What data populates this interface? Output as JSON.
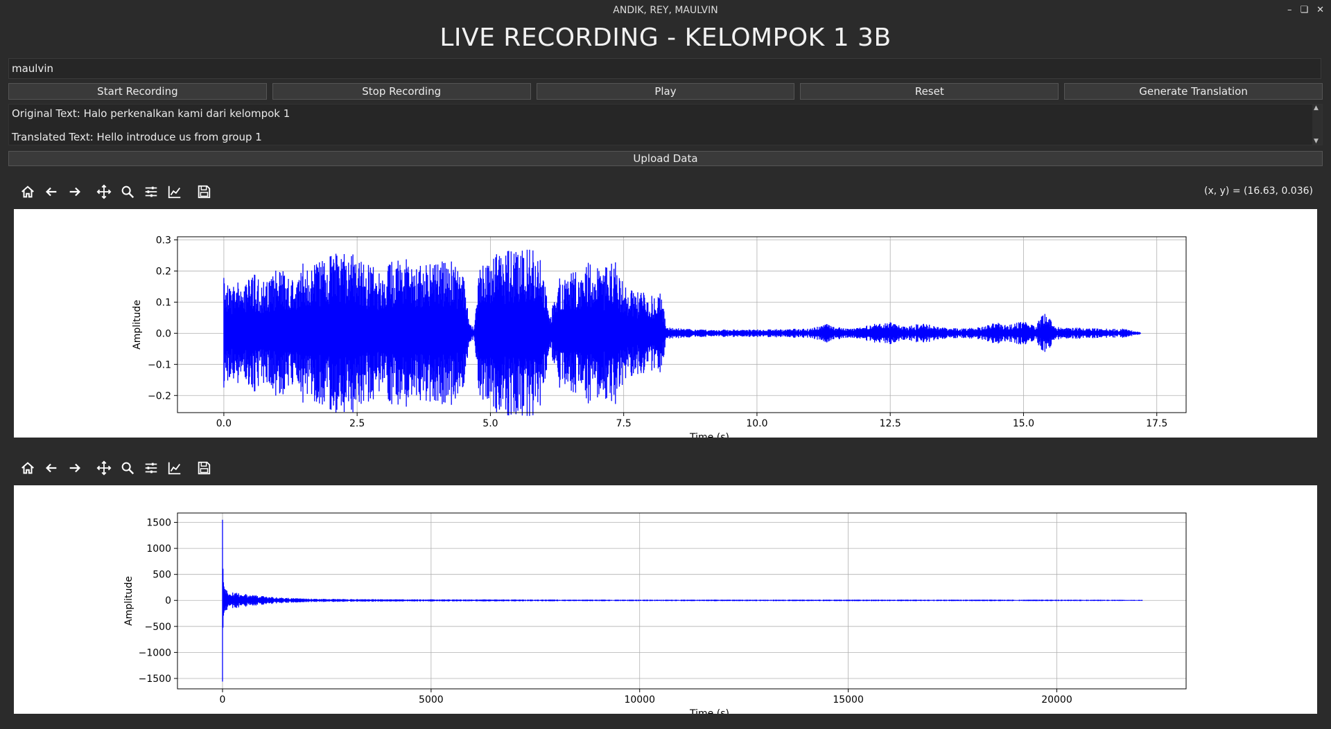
{
  "window": {
    "title": "ANDIK, REY, MAULVIN",
    "controls": [
      "minimize-icon",
      "restore-icon",
      "close-icon"
    ]
  },
  "app_title": "LIVE RECORDING - KELOMPOK 1 3B",
  "name_field": {
    "value": "maulvin"
  },
  "buttons": {
    "start": "Start Recording",
    "stop": "Stop Recording",
    "play": "Play",
    "reset": "Reset",
    "generate": "Generate Translation",
    "upload": "Upload Data"
  },
  "output": {
    "original": "Original Text: Halo perkenalkan kami dari kelompok 1",
    "translated": "Translated Text: Hello introduce us from group 1"
  },
  "toolbar_icons": [
    "home-icon",
    "back-icon",
    "forward-icon",
    "pan-icon",
    "zoom-icon",
    "configure-subplots-icon",
    "edit-axes-icon",
    "save-icon"
  ],
  "coords_readout": "(x, y) = (16.63, 0.036)",
  "colors": {
    "signal": "#0000ff",
    "background": "#2b2b2b",
    "button": "#3a3a3a"
  },
  "chart_data": [
    {
      "type": "line",
      "title": "",
      "xlabel": "Time (s)",
      "ylabel": "Amplitude",
      "xlim": [
        -0.87,
        18.05
      ],
      "ylim": [
        -0.255,
        0.31
      ],
      "xticks": [
        0.0,
        2.5,
        5.0,
        7.5,
        10.0,
        12.5,
        15.0,
        17.5
      ],
      "xtick_labels": [
        "0.0",
        "2.5",
        "5.0",
        "7.5",
        "10.0",
        "12.5",
        "15.0",
        "17.5"
      ],
      "yticks": [
        -0.2,
        -0.1,
        0.0,
        0.1,
        0.2,
        0.3
      ],
      "ytick_labels": [
        "−0.2",
        "−0.1",
        "0.0",
        "0.1",
        "0.2",
        "0.3"
      ],
      "grid": true,
      "color": "#0000ff",
      "duration": 17.2,
      "envelope": [
        [
          0.0,
          0.19
        ],
        [
          0.1,
          0.15
        ],
        [
          0.3,
          0.18
        ],
        [
          0.5,
          0.2
        ],
        [
          0.7,
          0.18
        ],
        [
          0.9,
          0.2
        ],
        [
          1.1,
          0.21
        ],
        [
          1.3,
          0.19
        ],
        [
          1.5,
          0.23
        ],
        [
          1.7,
          0.22
        ],
        [
          1.9,
          0.25
        ],
        [
          2.1,
          0.26
        ],
        [
          2.3,
          0.26
        ],
        [
          2.5,
          0.25
        ],
        [
          2.7,
          0.22
        ],
        [
          2.9,
          0.21
        ],
        [
          3.1,
          0.23
        ],
        [
          3.3,
          0.25
        ],
        [
          3.5,
          0.24
        ],
        [
          3.7,
          0.22
        ],
        [
          3.9,
          0.23
        ],
        [
          4.1,
          0.24
        ],
        [
          4.3,
          0.23
        ],
        [
          4.5,
          0.21
        ],
        [
          4.6,
          0.03
        ],
        [
          4.7,
          0.02
        ],
        [
          4.8,
          0.22
        ],
        [
          5.0,
          0.25
        ],
        [
          5.2,
          0.26
        ],
        [
          5.4,
          0.27
        ],
        [
          5.5,
          0.26
        ],
        [
          5.7,
          0.28
        ],
        [
          5.9,
          0.27
        ],
        [
          6.0,
          0.2
        ],
        [
          6.1,
          0.05
        ],
        [
          6.3,
          0.18
        ],
        [
          6.5,
          0.22
        ],
        [
          6.7,
          0.21
        ],
        [
          6.9,
          0.24
        ],
        [
          7.1,
          0.2
        ],
        [
          7.3,
          0.25
        ],
        [
          7.5,
          0.16
        ],
        [
          7.7,
          0.13
        ],
        [
          7.9,
          0.14
        ],
        [
          8.1,
          0.11
        ],
        [
          8.2,
          0.14
        ],
        [
          8.3,
          0.02
        ],
        [
          8.6,
          0.015
        ],
        [
          9.0,
          0.012
        ],
        [
          9.5,
          0.012
        ],
        [
          10.0,
          0.012
        ],
        [
          10.5,
          0.014
        ],
        [
          11.0,
          0.015
        ],
        [
          11.3,
          0.03
        ],
        [
          11.5,
          0.02
        ],
        [
          11.8,
          0.015
        ],
        [
          12.2,
          0.03
        ],
        [
          12.5,
          0.035
        ],
        [
          12.8,
          0.02
        ],
        [
          13.1,
          0.035
        ],
        [
          13.4,
          0.02
        ],
        [
          13.8,
          0.015
        ],
        [
          14.2,
          0.02
        ],
        [
          14.5,
          0.035
        ],
        [
          14.7,
          0.025
        ],
        [
          15.0,
          0.04
        ],
        [
          15.2,
          0.025
        ],
        [
          15.4,
          0.07
        ],
        [
          15.6,
          0.02
        ],
        [
          16.0,
          0.018
        ],
        [
          16.5,
          0.015
        ],
        [
          16.9,
          0.015
        ],
        [
          17.2,
          0.003
        ]
      ]
    },
    {
      "type": "line",
      "title": "",
      "xlabel": "Time (s)",
      "ylabel": "Amplitude",
      "xlim": [
        -1080,
        23100
      ],
      "ylim": [
        -1700,
        1680
      ],
      "xticks": [
        0,
        5000,
        10000,
        15000,
        20000
      ],
      "xtick_labels": [
        "0",
        "5000",
        "10000",
        "15000",
        "20000"
      ],
      "yticks": [
        -1500,
        -1000,
        -500,
        0,
        500,
        1000,
        1500
      ],
      "ytick_labels": [
        "−1500",
        "−1000",
        "−500",
        "0",
        "500",
        "1000",
        "1500"
      ],
      "grid": true,
      "color": "#0000ff",
      "spike": {
        "x": 0,
        "max": 1550,
        "min": -1560
      },
      "envelope": [
        [
          0,
          1550
        ],
        [
          30,
          450
        ],
        [
          100,
          200
        ],
        [
          300,
          150
        ],
        [
          600,
          120
        ],
        [
          1000,
          80
        ],
        [
          1500,
          50
        ],
        [
          2000,
          35
        ],
        [
          3000,
          25
        ],
        [
          5000,
          20
        ],
        [
          10000,
          15
        ],
        [
          15000,
          15
        ],
        [
          20000,
          15
        ],
        [
          22050,
          10
        ]
      ]
    }
  ]
}
